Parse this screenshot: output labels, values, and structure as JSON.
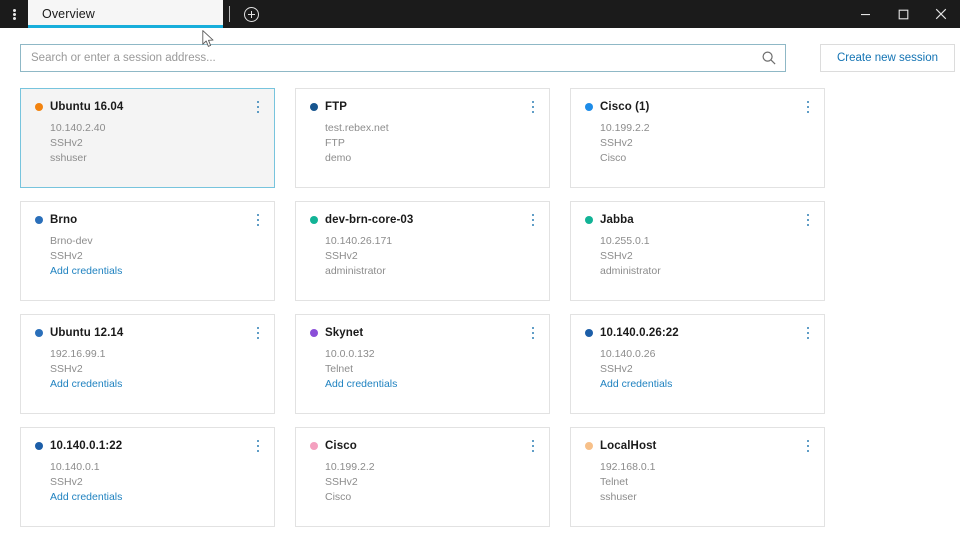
{
  "titlebar": {
    "menu_icon": "kebab-menu-icon",
    "tab_label": "Overview",
    "new_tab_icon": "plus-circle-icon",
    "minimize_icon": "minimize-icon",
    "maximize_icon": "maximize-icon",
    "close_icon": "close-icon",
    "accent_color": "#18aedb",
    "background_color": "#1b1b1b"
  },
  "toolbar": {
    "search_placeholder": "Search or enter a session address...",
    "search_value": "",
    "search_icon": "search-icon",
    "create_session_label": "Create new session",
    "link_color": "#1474b4"
  },
  "cards": [
    {
      "title": "Ubuntu 16.04",
      "dot_color": "#f2830f",
      "selected": true,
      "lines": [
        {
          "text": "10.140.2.40",
          "link": false
        },
        {
          "text": "SSHv2",
          "link": false
        },
        {
          "text": "sshuser",
          "link": false
        }
      ]
    },
    {
      "title": "FTP",
      "dot_color": "#17558f",
      "selected": false,
      "lines": [
        {
          "text": "test.rebex.net",
          "link": false
        },
        {
          "text": "FTP",
          "link": false
        },
        {
          "text": "demo",
          "link": false
        }
      ]
    },
    {
      "title": "Cisco (1)",
      "dot_color": "#1e8ce8",
      "selected": false,
      "lines": [
        {
          "text": "10.199.2.2",
          "link": false
        },
        {
          "text": "SSHv2",
          "link": false
        },
        {
          "text": "Cisco",
          "link": false
        }
      ]
    },
    {
      "title": "Brno",
      "dot_color": "#2a6fba",
      "selected": false,
      "lines": [
        {
          "text": "Brno-dev",
          "link": false
        },
        {
          "text": "SSHv2",
          "link": false
        },
        {
          "text": "Add credentials",
          "link": true
        }
      ]
    },
    {
      "title": "dev-brn-core-03",
      "dot_color": "#12b396",
      "selected": false,
      "lines": [
        {
          "text": "10.140.26.171",
          "link": false
        },
        {
          "text": "SSHv2",
          "link": false
        },
        {
          "text": "administrator",
          "link": false
        }
      ]
    },
    {
      "title": "Jabba",
      "dot_color": "#12b396",
      "selected": false,
      "lines": [
        {
          "text": "10.255.0.1",
          "link": false
        },
        {
          "text": "SSHv2",
          "link": false
        },
        {
          "text": "administrator",
          "link": false
        }
      ]
    },
    {
      "title": "Ubuntu 12.14",
      "dot_color": "#2a6fba",
      "selected": false,
      "lines": [
        {
          "text": "192.16.99.1",
          "link": false
        },
        {
          "text": "SSHv2",
          "link": false
        },
        {
          "text": "Add credentials",
          "link": true
        }
      ]
    },
    {
      "title": "Skynet",
      "dot_color": "#8a4ed8",
      "selected": false,
      "lines": [
        {
          "text": "10.0.0.132",
          "link": false
        },
        {
          "text": "Telnet",
          "link": false
        },
        {
          "text": "Add credentials",
          "link": true
        }
      ]
    },
    {
      "title": "10.140.0.26:22",
      "dot_color": "#1c5ea8",
      "selected": false,
      "lines": [
        {
          "text": "10.140.0.26",
          "link": false
        },
        {
          "text": "SSHv2",
          "link": false
        },
        {
          "text": "Add credentials",
          "link": true
        }
      ]
    },
    {
      "title": "10.140.0.1:22",
      "dot_color": "#1c5ea8",
      "selected": false,
      "lines": [
        {
          "text": "10.140.0.1",
          "link": false
        },
        {
          "text": "SSHv2",
          "link": false
        },
        {
          "text": "Add credentials",
          "link": true
        }
      ]
    },
    {
      "title": "Cisco",
      "dot_color": "#f4a0bf",
      "selected": false,
      "lines": [
        {
          "text": "10.199.2.2",
          "link": false
        },
        {
          "text": "SSHv2",
          "link": false
        },
        {
          "text": "Cisco",
          "link": false
        }
      ]
    },
    {
      "title": "LocalHost",
      "dot_color": "#f7c089",
      "selected": false,
      "lines": [
        {
          "text": "192.168.0.1",
          "link": false
        },
        {
          "text": "Telnet",
          "link": false
        },
        {
          "text": "sshuser",
          "link": false
        }
      ]
    }
  ]
}
